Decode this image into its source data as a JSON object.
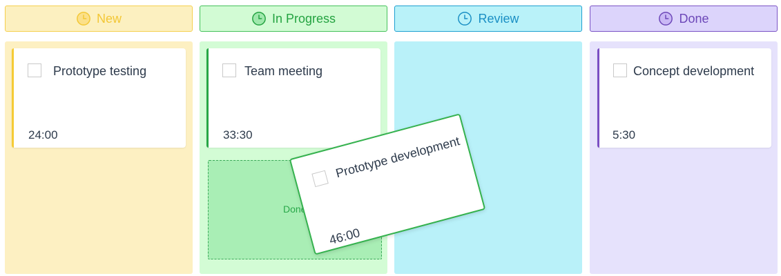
{
  "columns": [
    {
      "id": "new",
      "title": "New",
      "icon": "clock-icon",
      "color": "#f3c735"
    },
    {
      "id": "progress",
      "title": "In Progress",
      "icon": "clock-icon",
      "color": "#24a341"
    },
    {
      "id": "review",
      "title": "Review",
      "icon": "clock-icon",
      "color": "#1a8fc4"
    },
    {
      "id": "done",
      "title": "Done",
      "icon": "clock-icon",
      "color": "#6c47b8"
    }
  ],
  "cards": {
    "new": [
      {
        "title": "Prototype testing",
        "time": "24:00"
      }
    ],
    "progress": [
      {
        "title": "Team meeting",
        "time": "33:30"
      }
    ],
    "done": [
      {
        "title": "Concept development",
        "time": "5:30"
      }
    ]
  },
  "drop_zone": {
    "label": "Done"
  },
  "dragging_card": {
    "title": "Prototype development",
    "time": "46:00"
  }
}
